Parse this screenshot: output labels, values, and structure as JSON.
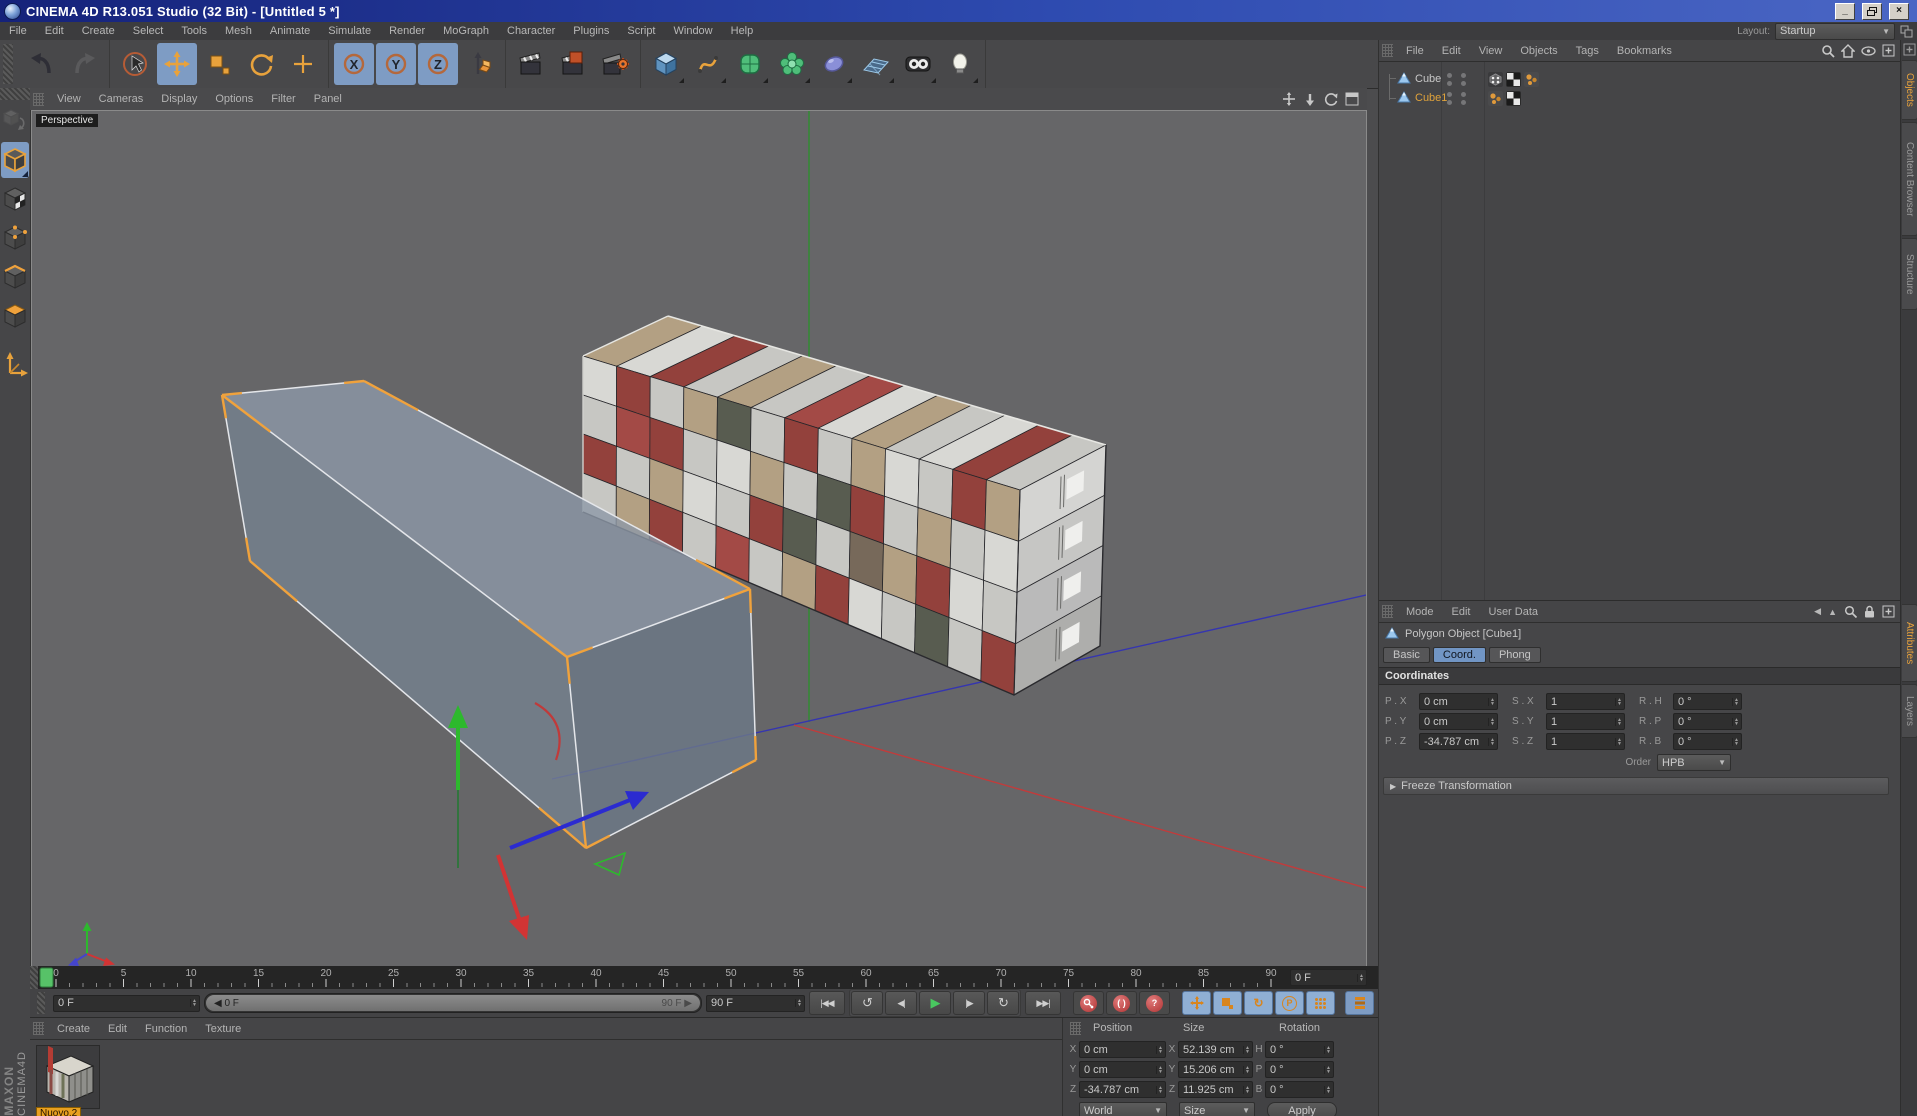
{
  "window": {
    "title": "CINEMA 4D R13.051 Studio (32 Bit) - [Untitled 5 *]"
  },
  "menubar": {
    "items": [
      "File",
      "Edit",
      "Create",
      "Select",
      "Tools",
      "Mesh",
      "Animate",
      "Simulate",
      "Render",
      "MoGraph",
      "Character",
      "Plugins",
      "Script",
      "Window",
      "Help"
    ],
    "layout_label": "Layout:",
    "layout_value": "Startup"
  },
  "viewport": {
    "menu": [
      "View",
      "Cameras",
      "Display",
      "Options",
      "Filter",
      "Panel"
    ],
    "label": "Perspective"
  },
  "object_manager": {
    "menu": [
      "File",
      "Edit",
      "View",
      "Objects",
      "Tags",
      "Bookmarks"
    ],
    "objects": [
      {
        "name": "Cube"
      },
      {
        "name": "Cube1"
      }
    ]
  },
  "side_tabs": {
    "top": [
      "Objects",
      "Content Browser",
      "Structure"
    ],
    "bottom": [
      "Attributes",
      "Layers"
    ]
  },
  "attributes": {
    "menu": [
      "Mode",
      "Edit",
      "User Data"
    ],
    "title": "Polygon Object [Cube1]",
    "tabs": [
      "Basic",
      "Coord.",
      "Phong"
    ],
    "section": "Coordinates",
    "rows": [
      {
        "p_label": "P . X",
        "p": "0 cm",
        "s_label": "S . X",
        "s": "1",
        "r_label": "R . H",
        "r": "0 °"
      },
      {
        "p_label": "P . Y",
        "p": "0 cm",
        "s_label": "S . Y",
        "s": "1",
        "r_label": "R . P",
        "r": "0 °"
      },
      {
        "p_label": "P . Z",
        "p": "-34.787 cm",
        "s_label": "S . Z",
        "s": "1",
        "r_label": "R . B",
        "r": "0 °"
      }
    ],
    "order_label": "Order",
    "order_value": "HPB",
    "freeze": "Freeze Transformation"
  },
  "timeline": {
    "tick_labels": [
      "0",
      "5",
      "10",
      "15",
      "20",
      "25",
      "30",
      "35",
      "40",
      "45",
      "50",
      "55",
      "60",
      "65",
      "70",
      "75",
      "80",
      "85",
      "90"
    ],
    "current": "0 F",
    "current_bottom": "0 F",
    "range_left": "◀ 0 F",
    "range_right": "90 F ▶",
    "end_frame": "90 F"
  },
  "materials": {
    "menu": [
      "Create",
      "Edit",
      "Function",
      "Texture"
    ],
    "items": [
      {
        "name": "Nuovo.2"
      }
    ]
  },
  "coords_panel": {
    "headers": [
      "Position",
      "Size",
      "Rotation"
    ],
    "rows": [
      {
        "a": "X",
        "pos": "0 cm",
        "b": "X",
        "size": "52.139 cm",
        "c": "H",
        "rot": "0 °"
      },
      {
        "a": "Y",
        "pos": "0 cm",
        "b": "Y",
        "size": "15.206 cm",
        "c": "P",
        "rot": "0 °"
      },
      {
        "a": "Z",
        "pos": "-34.787 cm",
        "b": "Z",
        "size": "11.925 cm",
        "c": "B",
        "rot": "0 °"
      }
    ],
    "mode": "World",
    "size_mode": "Size",
    "apply": "Apply"
  },
  "branding": {
    "maxon": "MAXON",
    "cinema": "CINEMA4D"
  },
  "glyphs": {
    "spin_up": "▲",
    "spin_down": "▼",
    "dropdown": "▼",
    "collapse": "▶",
    "goto_start": "|◀◀",
    "goto_end": "▶▶|",
    "step_back": "◀|",
    "step_fwd": "|▶",
    "play": "▶",
    "loop_ccw": "↺",
    "loop_cw": "↻",
    "parens": "( )",
    "question": "?",
    "minimize": "_",
    "close": "×"
  },
  "scene": {
    "container_palette": [
      "#93413c",
      "#6e7258",
      "#c7c7c3",
      "#b3a083",
      "#7b848d",
      "#585c50",
      "#a34a46",
      "#d8d8d4",
      "#8b8f7a",
      "#77695a"
    ],
    "front_pattern": [
      [
        7,
        0,
        2,
        3,
        5,
        2,
        0,
        2,
        3,
        7,
        2,
        0,
        3
      ],
      [
        2,
        6,
        0,
        2,
        7,
        3,
        2,
        5,
        0,
        2,
        3,
        2,
        7
      ],
      [
        0,
        2,
        3,
        7,
        2,
        0,
        5,
        2,
        9,
        3,
        0,
        7,
        2
      ],
      [
        2,
        3,
        0,
        2,
        6,
        2,
        3,
        0,
        7,
        2,
        5,
        2,
        0
      ]
    ],
    "top_pattern": [
      3,
      7,
      0,
      2,
      3,
      2,
      6,
      7,
      3,
      2,
      7,
      0,
      2
    ],
    "right_bands": [
      "#d4d4d2",
      "#c6c6c4",
      "#bababa",
      "#aeaeac"
    ],
    "axis_x": "#c23b3b",
    "axis_y": "#2f8f2f",
    "axis_z": "#3535b0"
  }
}
